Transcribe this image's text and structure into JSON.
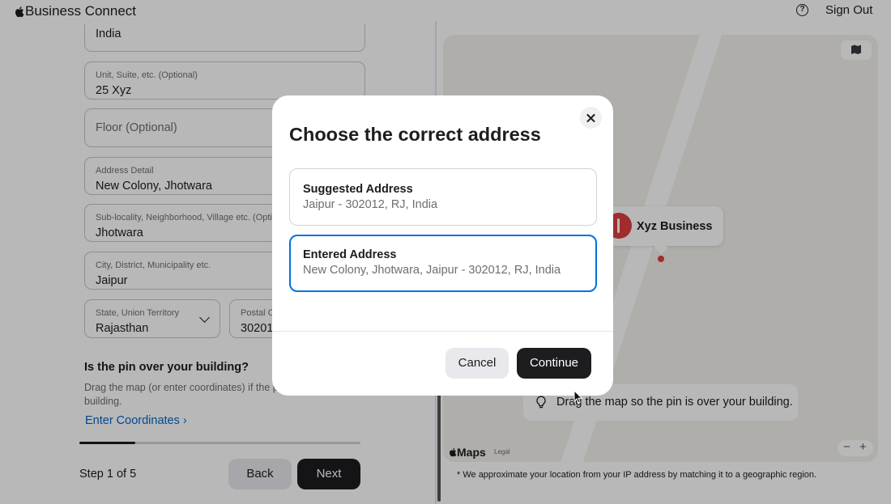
{
  "header": {
    "brand": "Business Connect",
    "sign_out": "Sign Out"
  },
  "form": {
    "country_value": "India",
    "unit": {
      "label": "Unit, Suite, etc. (Optional)",
      "value": "25 Xyz"
    },
    "floor": {
      "placeholder": "Floor (Optional)"
    },
    "address_detail": {
      "label": "Address Detail",
      "value": "New Colony, Jhotwara"
    },
    "sublocality": {
      "label": "Sub-locality, Neighborhood, Village etc. (Optio",
      "value": "Jhotwara"
    },
    "city": {
      "label": "City, District, Municipality etc.",
      "value": "Jaipur"
    },
    "state": {
      "label": "State, Union Territory",
      "value": "Rajasthan"
    },
    "postal": {
      "label": "Postal C",
      "value": "30201"
    }
  },
  "pin_section": {
    "question": "Is the pin over your building?",
    "description": "Drag the map (or enter coordinates) if the p building.",
    "enter_coordinates": "Enter Coordinates"
  },
  "progress": {
    "fraction": 0.2,
    "step_label": "Step 1 of 5"
  },
  "nav": {
    "back": "Back",
    "next": "Next"
  },
  "map": {
    "business_name": "Xyz Business",
    "hint": "Drag the map so the pin is over your building.",
    "maps_label": "Maps",
    "legal": "Legal",
    "zoom_out": "−",
    "zoom_in": "+",
    "footnote": "* We approximate your location from your IP address by matching it to a geographic region."
  },
  "dialog": {
    "title": "Choose the correct address",
    "options": [
      {
        "title": "Suggested Address",
        "address": "Jaipur - 302012, RJ, India",
        "selected": false
      },
      {
        "title": "Entered Address",
        "address": "New Colony, Jhotwara, Jaipur - 302012, RJ, India",
        "selected": true
      }
    ],
    "cancel": "Cancel",
    "continue": "Continue"
  },
  "colors": {
    "accent": "#0071e3",
    "pin": "#e03e3e",
    "primary_button": "#1d1d1f",
    "link": "#0066cc"
  }
}
